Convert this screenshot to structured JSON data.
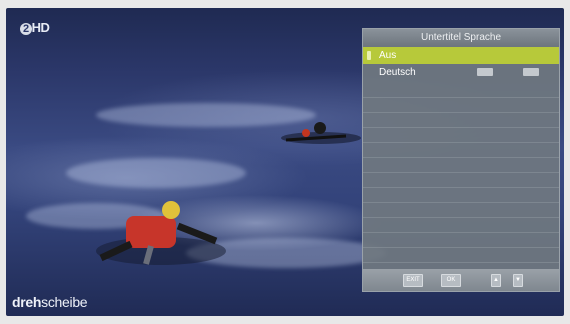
{
  "channel_logo": {
    "prefix": "2",
    "suffix": "HD"
  },
  "brand_text": {
    "bold": "dreh",
    "rest": "scheibe"
  },
  "subtitle_menu": {
    "title": "Untertitel Sprache",
    "options": [
      {
        "label": "Aus",
        "selected": true
      },
      {
        "label": "Deutsch",
        "selected": false
      }
    ],
    "footer_buttons": {
      "exit": "EXIT",
      "ok": "OK",
      "up": "▲",
      "down": "▼"
    }
  },
  "colors": {
    "selection": "#b7c93a",
    "panel": "#707880"
  }
}
